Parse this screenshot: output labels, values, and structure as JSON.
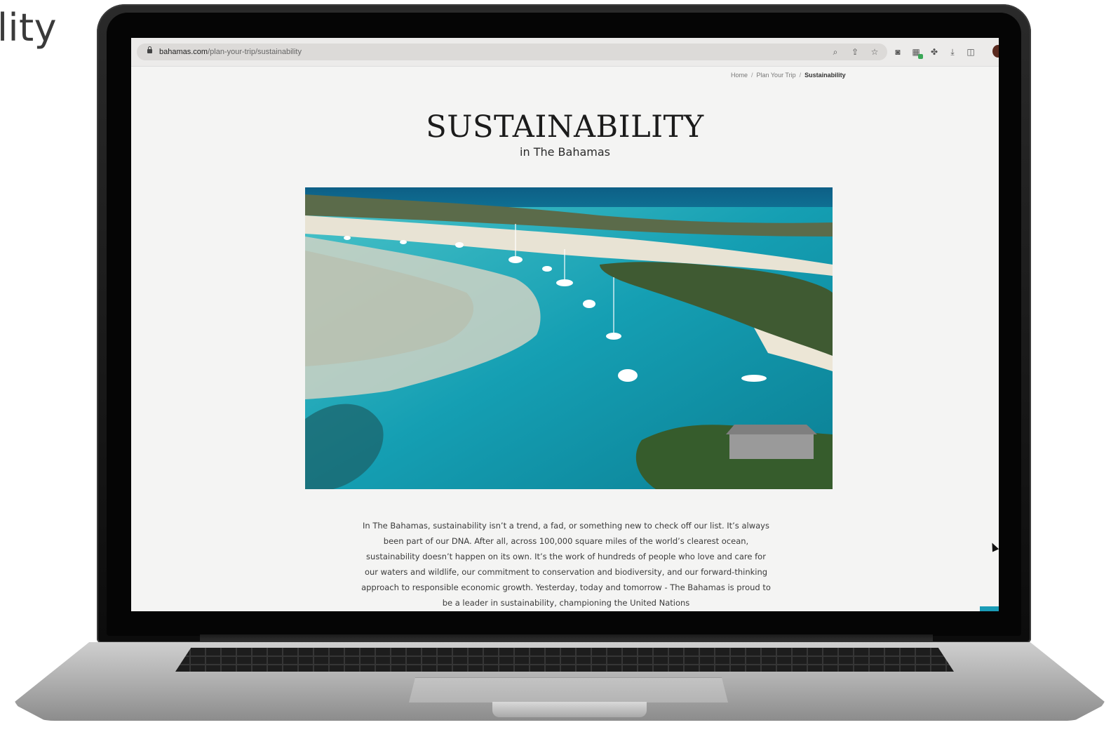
{
  "slide_title": "lity",
  "browser": {
    "url_domain": "bahamas.com",
    "url_path": "/plan-your-trip/sustainability",
    "icons": [
      "zoom-icon",
      "share-icon",
      "star-icon"
    ],
    "toolbar_icons": [
      "camera-icon",
      "extension-green-icon",
      "puzzle-icon",
      "download-icon",
      "sidebar-icon"
    ]
  },
  "page": {
    "breadcrumb": [
      "Home",
      "Plan Your Trip",
      "Sustainability"
    ],
    "breadcrumb_sep": "/",
    "title": "SUSTAINABILITY",
    "subtitle": "in The Bahamas",
    "hero_image": "aerial-bay-boats",
    "body": "In The Bahamas, sustainability isn’t a trend, a fad, or something new to check off our list. It’s always been part of our DNA. After all, across 100,000 square miles of the world’s clearest ocean, sustainability doesn’t happen on its own. It’s the work of hundreds of people who love and care for our waters and wildlife, our commitment to conservation and biodiversity, and our forward-thinking approach to responsible economic growth. Yesterday, today and tomorrow - The Bahamas is proud to be a leader in sustainability, championing the United Nations"
  },
  "colors": {
    "accent": "#1a9cb7",
    "page_bg": "#f4f4f3",
    "text": "#1b1b1b"
  }
}
